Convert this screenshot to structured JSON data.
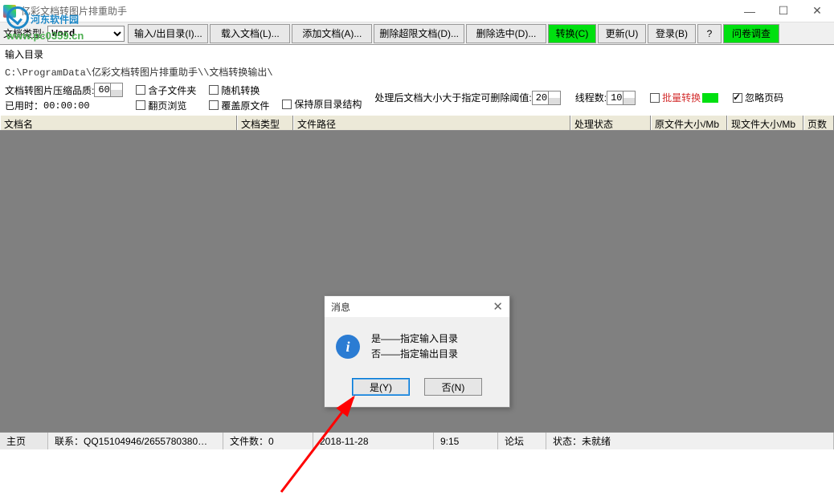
{
  "window_title": "亿彩文档转图片排重助手",
  "watermark": {
    "line1": "河东软件园",
    "line2": "www.pc0359.cn"
  },
  "toolbar": {
    "doc_type_label": "文档类型:",
    "doc_type_value": "Word",
    "buttons": {
      "io_dir": "输入/出目录(I)...",
      "load_doc": "载入文档(L)...",
      "add_doc": "添加文档(A)...",
      "del_over": "删除超限文档(D)...",
      "del_sel": "删除选中(D)...",
      "convert": "转换(C)",
      "update": "更新(U)",
      "login": "登录(B)",
      "help": "?",
      "survey": "问卷调查"
    }
  },
  "input_dir_label": "输入目录",
  "input_dir_path": "C:\\ProgramData\\亿彩文档转图片排重助手\\\\文档转换输出\\",
  "opts": {
    "quality_label": "文档转图片压缩品质:",
    "quality_value": "60",
    "elapsed_label": "已用时：",
    "elapsed_value": "00:00:00",
    "inc_sub": "含子文件夹",
    "flip_preview": "翻页浏览",
    "random_conv": "随机转换",
    "overwrite": "覆盖原文件",
    "keep_struct": "保持原目录结构",
    "limit_label": "处理后文档大小大于指定可删除阈值:",
    "limit_value": "20",
    "threads_label": "线程数:",
    "threads_value": "10",
    "batch_label": "批量转换",
    "ignore_pagenum": "忽略页码"
  },
  "columns": {
    "c1": "文档名",
    "c2": "文档类型",
    "c3": "文件路径",
    "c4": "处理状态",
    "c5": "原文件大小/Mb",
    "c6": "现文件大小/Mb",
    "c7": "页数"
  },
  "dialog": {
    "title": "消息",
    "line1": "是——指定输入目录",
    "line2": "否——指定输出目录",
    "yes": "是(Y)",
    "no": "否(N)"
  },
  "status": {
    "homepage": "主页",
    "contact": "联系：QQ15104946/2655780380…",
    "filecount": "文件数：0",
    "date": "2018-11-28",
    "time": "9:15",
    "forum": "论坛",
    "state": "状态：未就绪"
  }
}
